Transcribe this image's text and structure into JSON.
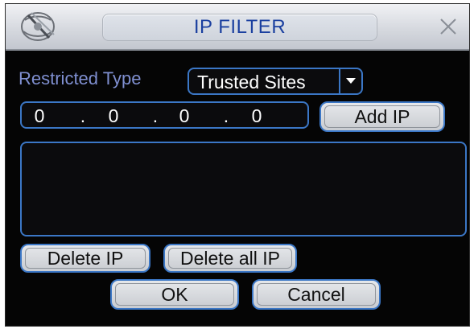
{
  "window": {
    "title": "IP FILTER",
    "logo_icon": "globe-logo-icon",
    "close_icon": "close-icon"
  },
  "filter": {
    "restricted_type_label": "Restricted Type",
    "restricted_type_value": "Trusted Sites",
    "dropdown_arrow_icon": "caret-down-icon"
  },
  "ip_input": {
    "octets": [
      "0",
      "0",
      "0",
      "0"
    ],
    "separator": "."
  },
  "buttons": {
    "add_ip": "Add IP",
    "delete_ip": "Delete IP",
    "delete_all_ip": "Delete all IP",
    "ok": "OK",
    "cancel": "Cancel"
  },
  "ip_list": {
    "items": []
  },
  "colors": {
    "background": "#050505",
    "accent_border": "#3b77c6",
    "label_text": "#7f8fd0",
    "title_text": "#1a3f9f"
  }
}
